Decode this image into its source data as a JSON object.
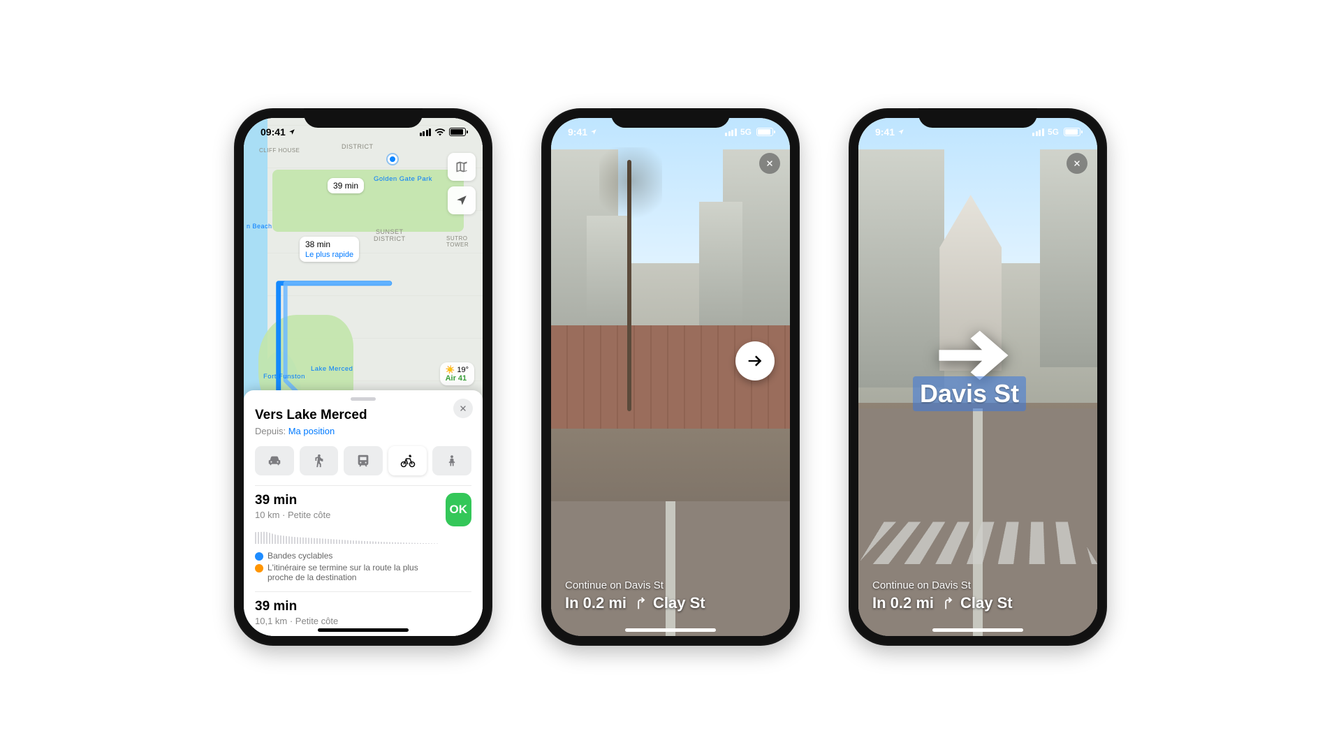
{
  "status": {
    "time": "09:41",
    "alt_time": "9:41",
    "network": "5G"
  },
  "phone1": {
    "map": {
      "labels": {
        "district": "DISTRICT",
        "sunset": "SUNSET\nDISTRICT",
        "ggp": "Golden Gate Park",
        "lake": "Lake Merced",
        "funston": "Fort Funston",
        "cliff": "CLIFF HOUSE",
        "sutro": "SUTRO TOWER",
        "beach": "n Beach"
      },
      "route_tag_1": "39 min",
      "route_tag_2_time": "38 min",
      "route_tag_2_fast": "Le plus rapide",
      "weather_temp": "19°",
      "weather_air": "Air 41"
    },
    "sheet": {
      "title": "Vers Lake Merced",
      "from_label": "Depuis:",
      "from_value": "Ma position",
      "modes": [
        "car",
        "walk",
        "transit",
        "bike",
        "rideshare"
      ],
      "selected_mode_index": 3,
      "routes": [
        {
          "time": "39 min",
          "sub": "10 km · Petite côte",
          "ok": "OK",
          "notes": [
            {
              "dot": "blue",
              "text": "Bandes cyclables"
            },
            {
              "dot": "orange",
              "text": "L'itinéraire se termine sur la route la plus proche de la destination"
            }
          ]
        },
        {
          "time": "39 min",
          "sub": "10,1 km · Petite côte"
        }
      ]
    }
  },
  "ar": {
    "continue_label": "Continue on Davis St",
    "next_distance": "In 0.2 mi",
    "next_street": "Clay St",
    "ar_street_label": "Davis St"
  }
}
